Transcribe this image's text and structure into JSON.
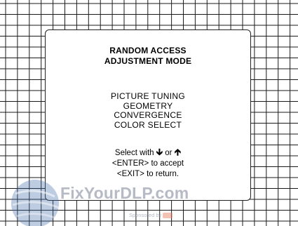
{
  "menu": {
    "title_line1": "RANDOM  ACCESS",
    "title_line2": "ADJUSTMENT MODE",
    "items": [
      "PICTURE  TUNING",
      "GEOMETRY",
      "CONVERGENCE",
      "COLOR  SELECT"
    ]
  },
  "instructions": {
    "line1_prefix": "Select with",
    "line1_or": "or",
    "line2": "<ENTER>  to  accept",
    "line3": "<EXIT>  to  return."
  },
  "icons": {
    "down_arrow": "arrow-down",
    "up_arrow": "arrow-up"
  },
  "watermark": {
    "text": "FixYourDLP.com",
    "sub": "Sponsored by"
  },
  "colors": {
    "grid_line": "#1a1a1a",
    "background": "#ffffff",
    "text": "#000000"
  }
}
